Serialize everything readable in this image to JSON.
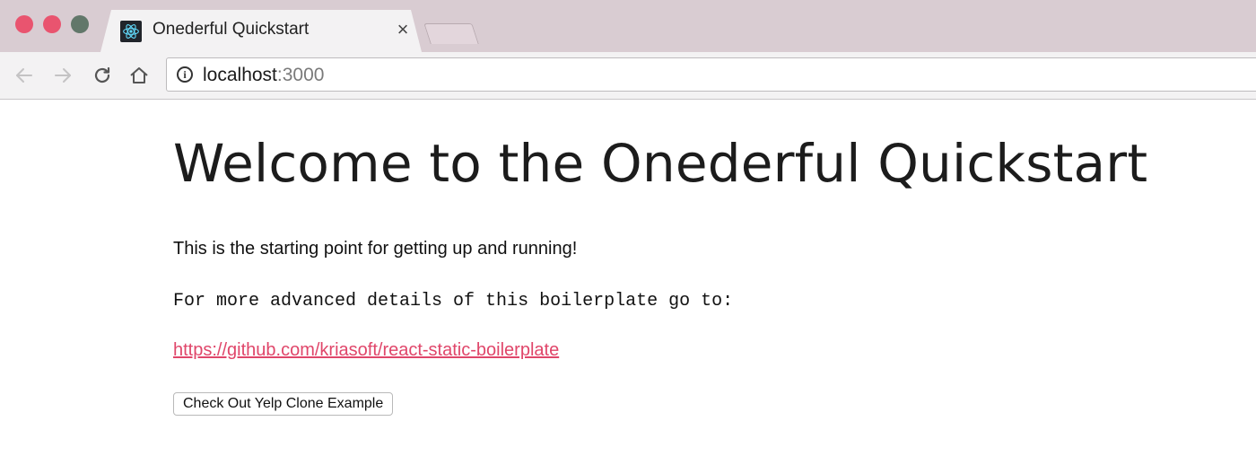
{
  "browser": {
    "tab": {
      "title": "Onederful Quickstart",
      "close_glyph": "×",
      "favicon": "react-atom-icon"
    },
    "address_bar": {
      "host": "localhost",
      "port": ":3000"
    },
    "colors": {
      "titlebar": "#d9ccd2",
      "tab": "#f3f2f3",
      "close_dot": "#e9546f",
      "max_dot": "#62776a"
    }
  },
  "page": {
    "title": "Welcome to the Onederful Quickstart",
    "intro": "This is the starting point for getting up and running!",
    "details_text": "For more advanced details of this boilerplate go to:",
    "repo_link": "https://github.com/kriasoft/react-static-boilerplate",
    "button_label": "Check Out Yelp Clone Example",
    "link_color": "#e0466a"
  }
}
